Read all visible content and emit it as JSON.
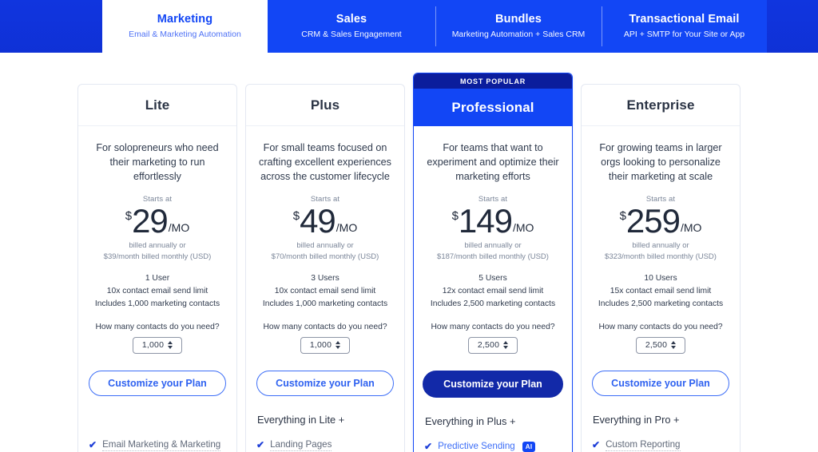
{
  "tabs": [
    {
      "title": "Marketing",
      "subtitle": "Email & Marketing Automation",
      "active": true
    },
    {
      "title": "Sales",
      "subtitle": "CRM & Sales Engagement",
      "active": false
    },
    {
      "title": "Bundles",
      "subtitle": "Marketing Automation + Sales CRM",
      "active": false
    },
    {
      "title": "Transactional Email",
      "subtitle": "API + SMTP for Your Site or App",
      "active": false
    }
  ],
  "colors": {
    "brand_blue": "#1246f5",
    "dark_blue": "#0b1d9c",
    "cta_solid": "#1229a8",
    "link_blue": "#3d6ef7",
    "text_dark": "#2b3445",
    "text_muted": "#7b8699"
  },
  "labels": {
    "starts_at": "Starts at",
    "contacts_question": "How many contacts do you need?",
    "cta": "Customize your Plan",
    "currency": "$",
    "period": "/MO",
    "most_popular": "MOST POPULAR",
    "ai_badge": "AI"
  },
  "plans": [
    {
      "name": "Lite",
      "featured": false,
      "blurb": "For solopreneurs who need their marketing to run effortlessly",
      "price": "29",
      "billing_line1": "billed annually or",
      "billing_line2": "$39/month billed monthly (USD)",
      "users": "1 User",
      "send_limit": "10x contact email send limit",
      "contacts_included": "Includes 1,000 marketing contacts",
      "contacts_value": "1,000",
      "everything_in": "",
      "features": [
        {
          "label": "Email Marketing & Marketing",
          "accent": false,
          "badge": ""
        }
      ]
    },
    {
      "name": "Plus",
      "featured": false,
      "blurb": "For small teams focused on crafting excellent experiences across the customer lifecycle",
      "price": "49",
      "billing_line1": "billed annually or",
      "billing_line2": "$70/month billed monthly (USD)",
      "users": "3 Users",
      "send_limit": "10x contact email send limit",
      "contacts_included": "Includes 1,000 marketing contacts",
      "contacts_value": "1,000",
      "everything_in": "Everything in Lite +",
      "features": [
        {
          "label": "Landing Pages",
          "accent": false,
          "badge": ""
        }
      ]
    },
    {
      "name": "Professional",
      "featured": true,
      "ribbon": "MOST POPULAR",
      "blurb": "For teams that want to experiment and optimize their marketing efforts",
      "price": "149",
      "billing_line1": "billed annually or",
      "billing_line2": "$187/month billed monthly (USD)",
      "users": "5 Users",
      "send_limit": "12x contact email send limit",
      "contacts_included": "Includes 2,500 marketing contacts",
      "contacts_value": "2,500",
      "everything_in": "Everything in Plus +",
      "features": [
        {
          "label": "Predictive Sending",
          "accent": true,
          "badge": "AI"
        }
      ]
    },
    {
      "name": "Enterprise",
      "featured": false,
      "blurb": "For growing teams in larger orgs looking to personalize their marketing at scale",
      "price": "259",
      "billing_line1": "billed annually or",
      "billing_line2": "$323/month billed monthly (USD)",
      "users": "10 Users",
      "send_limit": "15x contact email send limit",
      "contacts_included": "Includes 2,500 marketing contacts",
      "contacts_value": "2,500",
      "everything_in": "Everything in Pro +",
      "features": [
        {
          "label": "Custom Reporting",
          "accent": false,
          "badge": ""
        }
      ]
    }
  ]
}
